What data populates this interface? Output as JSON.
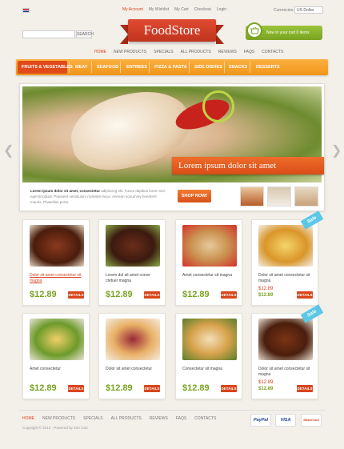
{
  "topbar": {
    "links": [
      "My Account",
      "My Wishlist",
      "My Cart",
      "Checkout",
      "Login"
    ],
    "currency_label": "Currencies:",
    "currency_value": "US Dollar"
  },
  "search": {
    "button": "SEARCH"
  },
  "logo": "FoodStore",
  "cart": {
    "text": "Now in your cart 0 items"
  },
  "topnav": [
    "HOME",
    "NEW PRODUCTS",
    "SPECIALS",
    "ALL PRODUCTS",
    "REVIEWS",
    "FAQS",
    "CONTACTS"
  ],
  "categories": [
    "FRUITS & VEGETABLES",
    "MEAT",
    "SEAFOOD",
    "ENTREES",
    "PIZZA & PASTA",
    "SIDE DISHES",
    "SNACKS",
    "DESSERTS"
  ],
  "slider": {
    "caption": "Lorem ipsum dolor sit amet",
    "text_bold": "Lorem ipsum dolor sit amet, consectetur",
    "text": "adipiscing elit. Fusce dapibus lorem nisl, eget tincidunt. Praesent vestibulum molestie lacus. Aenean nonummy hendrerit mauris. Phasellus porta.",
    "button": "SHOP NOW!"
  },
  "products": [
    {
      "name": "Dolor sit amet consectetur sit magna",
      "price": "$12.89",
      "details": "DETAILS",
      "highlight": true
    },
    {
      "name": "Lorem dol sit amet conse ctetuer magna",
      "price": "$12.89",
      "details": "DETAILS"
    },
    {
      "name": "Amet consectetur sit magna",
      "price": "$12.89",
      "details": "DETAILS"
    },
    {
      "name": "Dolor sit amet consectetur sit magna",
      "old_price": "$12.89",
      "new_price": "$12.89",
      "details": "DETAILS",
      "sale": "Sale"
    },
    {
      "name": "Amet consectetur",
      "price": "$12.89",
      "details": "DETAILS"
    },
    {
      "name": "Dolor sit amet consectetur",
      "price": "$12.89",
      "details": "DETAILS"
    },
    {
      "name": "Consectetur sit magna",
      "price": "$12.89",
      "details": "DETAILS"
    },
    {
      "name": "Dolor sit amet consectetur sit magna",
      "old_price": "$12.89",
      "new_price": "$12.89",
      "details": "DETAILS",
      "sale": "Sale"
    }
  ],
  "footer": {
    "nav": [
      "HOME",
      "NEW PRODUCTS",
      "SPECIALS",
      "ALL PRODUCTS",
      "REVIEWS",
      "FAQS",
      "CONTACTS"
    ],
    "copyright": "Copyright © 2012 · Powered by Zen Cart",
    "payments": [
      "PayPal",
      "VISA",
      "MasterCard"
    ]
  },
  "colors": {
    "accent": "#d8421e",
    "green": "#7aa321",
    "orange": "#f0951a",
    "sale": "#5cc7e6"
  }
}
